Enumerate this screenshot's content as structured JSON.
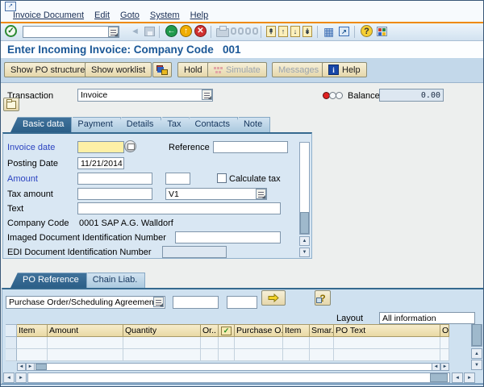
{
  "window": {
    "menu": [
      "Invoice Document",
      "Edit",
      "Goto",
      "System",
      "Help"
    ],
    "title": "Enter Incoming Invoice: Company Code   001"
  },
  "toolbar": {
    "command_value": ""
  },
  "app_toolbar": {
    "show_po_structure": "Show PO structure",
    "show_worklist": "Show worklist",
    "hold": "Hold",
    "simulate": "Simulate",
    "messages": "Messages",
    "help": "Help"
  },
  "header": {
    "transaction_label": "Transaction",
    "transaction_value": "Invoice",
    "balance_label": "Balance",
    "balance_value": "0.00"
  },
  "tabs": {
    "basic_data": "Basic data",
    "payment": "Payment",
    "details": "Details",
    "tax": "Tax",
    "contacts": "Contacts",
    "note": "Note"
  },
  "basic_data": {
    "invoice_date_label": "Invoice date",
    "invoice_date_value": "",
    "reference_label": "Reference",
    "reference_value": "",
    "posting_date_label": "Posting Date",
    "posting_date_value": "11/21/2014",
    "amount_label": "Amount",
    "amount_value": "",
    "currency_value": "",
    "calculate_tax_label": "Calculate tax",
    "tax_amount_label": "Tax amount",
    "tax_amount_value": "",
    "tax_code_value": "V1",
    "text_label": "Text",
    "text_value": "",
    "company_code_label": "Company Code",
    "company_code_value": "0001 SAP A.G. Walldorf",
    "imaged_doc_label": "Imaged Document Identification Number",
    "imaged_doc_value": "",
    "edi_doc_label": "EDI Document Identification Number"
  },
  "po_section": {
    "tab_po_reference": "PO Reference",
    "tab_chain_liab": "Chain Liab.",
    "reference_doc_type": "Purchase Order/Scheduling Agreement",
    "po_number_value": "",
    "po_item_value": "",
    "layout_label": "Layout",
    "layout_value": "All information",
    "table_columns": [
      "Item",
      "Amount",
      "Quantity",
      "Or..",
      "Purchase O..",
      "Item",
      "Smar..",
      "PO Text",
      "O"
    ]
  },
  "glyphs": {
    "check": "✓",
    "back_arrow": "←",
    "up_arrow": "↑",
    "down_arrow": "↓",
    "cancel_x": "✕",
    "question": "?",
    "info": "i",
    "ne_arrow": "↗",
    "grid": "▦",
    "tri_left": "◄",
    "tri_right": "►",
    "tri_up": "▲",
    "tri_down": "▼",
    "first_page": "↟",
    "last_page": "↡"
  }
}
